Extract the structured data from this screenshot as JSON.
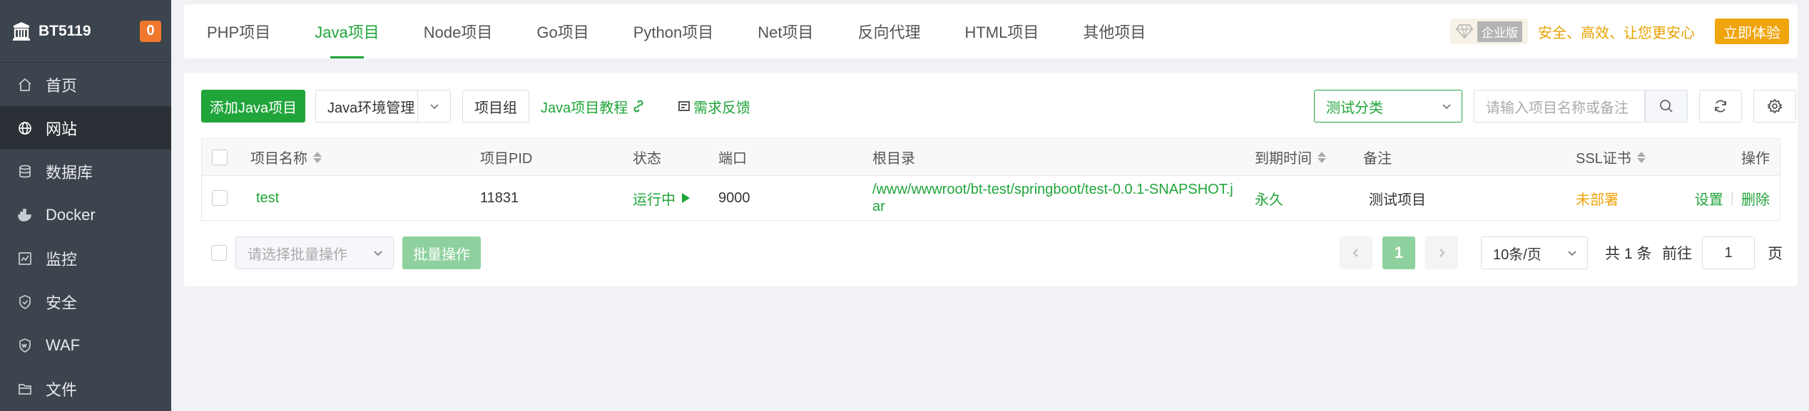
{
  "brand": {
    "name": "BT5119",
    "badge": "0"
  },
  "sidebar": {
    "items": [
      {
        "label": "首页",
        "icon": "home-icon"
      },
      {
        "label": "网站",
        "icon": "globe-icon",
        "active": true
      },
      {
        "label": "数据库",
        "icon": "database-icon"
      },
      {
        "label": "Docker",
        "icon": "docker-icon"
      },
      {
        "label": "监控",
        "icon": "monitor-icon"
      },
      {
        "label": "安全",
        "icon": "shield-icon"
      },
      {
        "label": "WAF",
        "icon": "waf-icon"
      },
      {
        "label": "文件",
        "icon": "folder-icon"
      }
    ]
  },
  "tabs": [
    {
      "label": "PHP项目"
    },
    {
      "label": "Java项目",
      "active": true
    },
    {
      "label": "Node项目"
    },
    {
      "label": "Go项目"
    },
    {
      "label": "Python项目"
    },
    {
      "label": "Net项目"
    },
    {
      "label": "反向代理"
    },
    {
      "label": "HTML项目"
    },
    {
      "label": "其他项目"
    }
  ],
  "promo": {
    "edition": "企业版",
    "slogan": "安全、高效、让您更安心",
    "try_label": "立即体验"
  },
  "toolbar": {
    "add_label": "添加Java项目",
    "env_label": "Java环境管理",
    "group_label": "项目组",
    "tutorial_label": "Java项目教程",
    "feedback_label": "需求反馈",
    "category_value": "测试分类",
    "search_placeholder": "请输入项目名称或备注"
  },
  "table": {
    "headers": {
      "name": "项目名称",
      "pid": "项目PID",
      "status": "状态",
      "port": "端口",
      "root": "根目录",
      "expire": "到期时间",
      "remark": "备注",
      "ssl": "SSL证书",
      "actions": "操作"
    },
    "rows": [
      {
        "name": "test",
        "pid": "11831",
        "status": "运行中",
        "port": "9000",
        "root_line1": "/www/wwwroot/bt-test/springboot/test-0.0.1-SNAPSHOT.j",
        "root_line2": "ar",
        "expire": "永久",
        "remark": "测试项目",
        "ssl": "未部署",
        "action_settings": "设置",
        "action_delete": "删除"
      }
    ]
  },
  "footer": {
    "batch_placeholder": "请选择批量操作",
    "batch_button": "批量操作",
    "current_page": "1",
    "page_size": "10条/页",
    "total_text": "共 1 条",
    "goto_label": "前往",
    "goto_value": "1",
    "page_unit": "页"
  },
  "colors": {
    "primary": "#20a53a",
    "sidebar_bg": "#3c444d",
    "sidebar_active": "#2a3036",
    "warning": "#f0a40d",
    "badge": "#f0772c"
  }
}
